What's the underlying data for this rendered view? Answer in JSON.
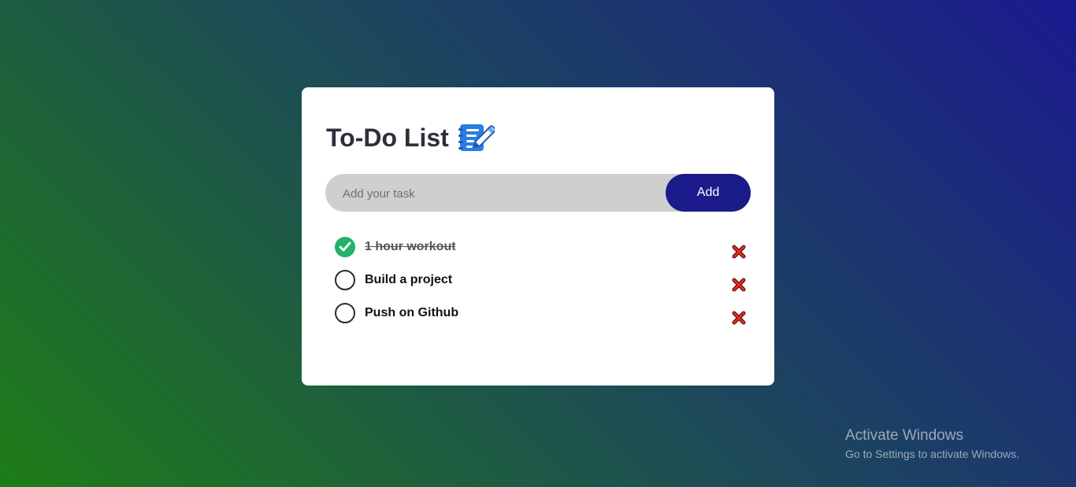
{
  "app": {
    "title": "To-Do List",
    "title_icon": "notes-pencil-icon"
  },
  "input": {
    "placeholder": "Add your task",
    "value": "",
    "add_label": "Add"
  },
  "tasks": [
    {
      "text": "1 hour workout",
      "checked": true
    },
    {
      "text": "Build a project",
      "checked": false
    },
    {
      "text": "Push on Github",
      "checked": false
    }
  ],
  "colors": {
    "accent": "#1c1b8b",
    "check_done": "#1fb36b",
    "delete": "#e22b1e",
    "input_bg": "#d0cfcd"
  },
  "watermark": {
    "line1": "Activate Windows",
    "line2": "Go to Settings to activate Windows."
  }
}
